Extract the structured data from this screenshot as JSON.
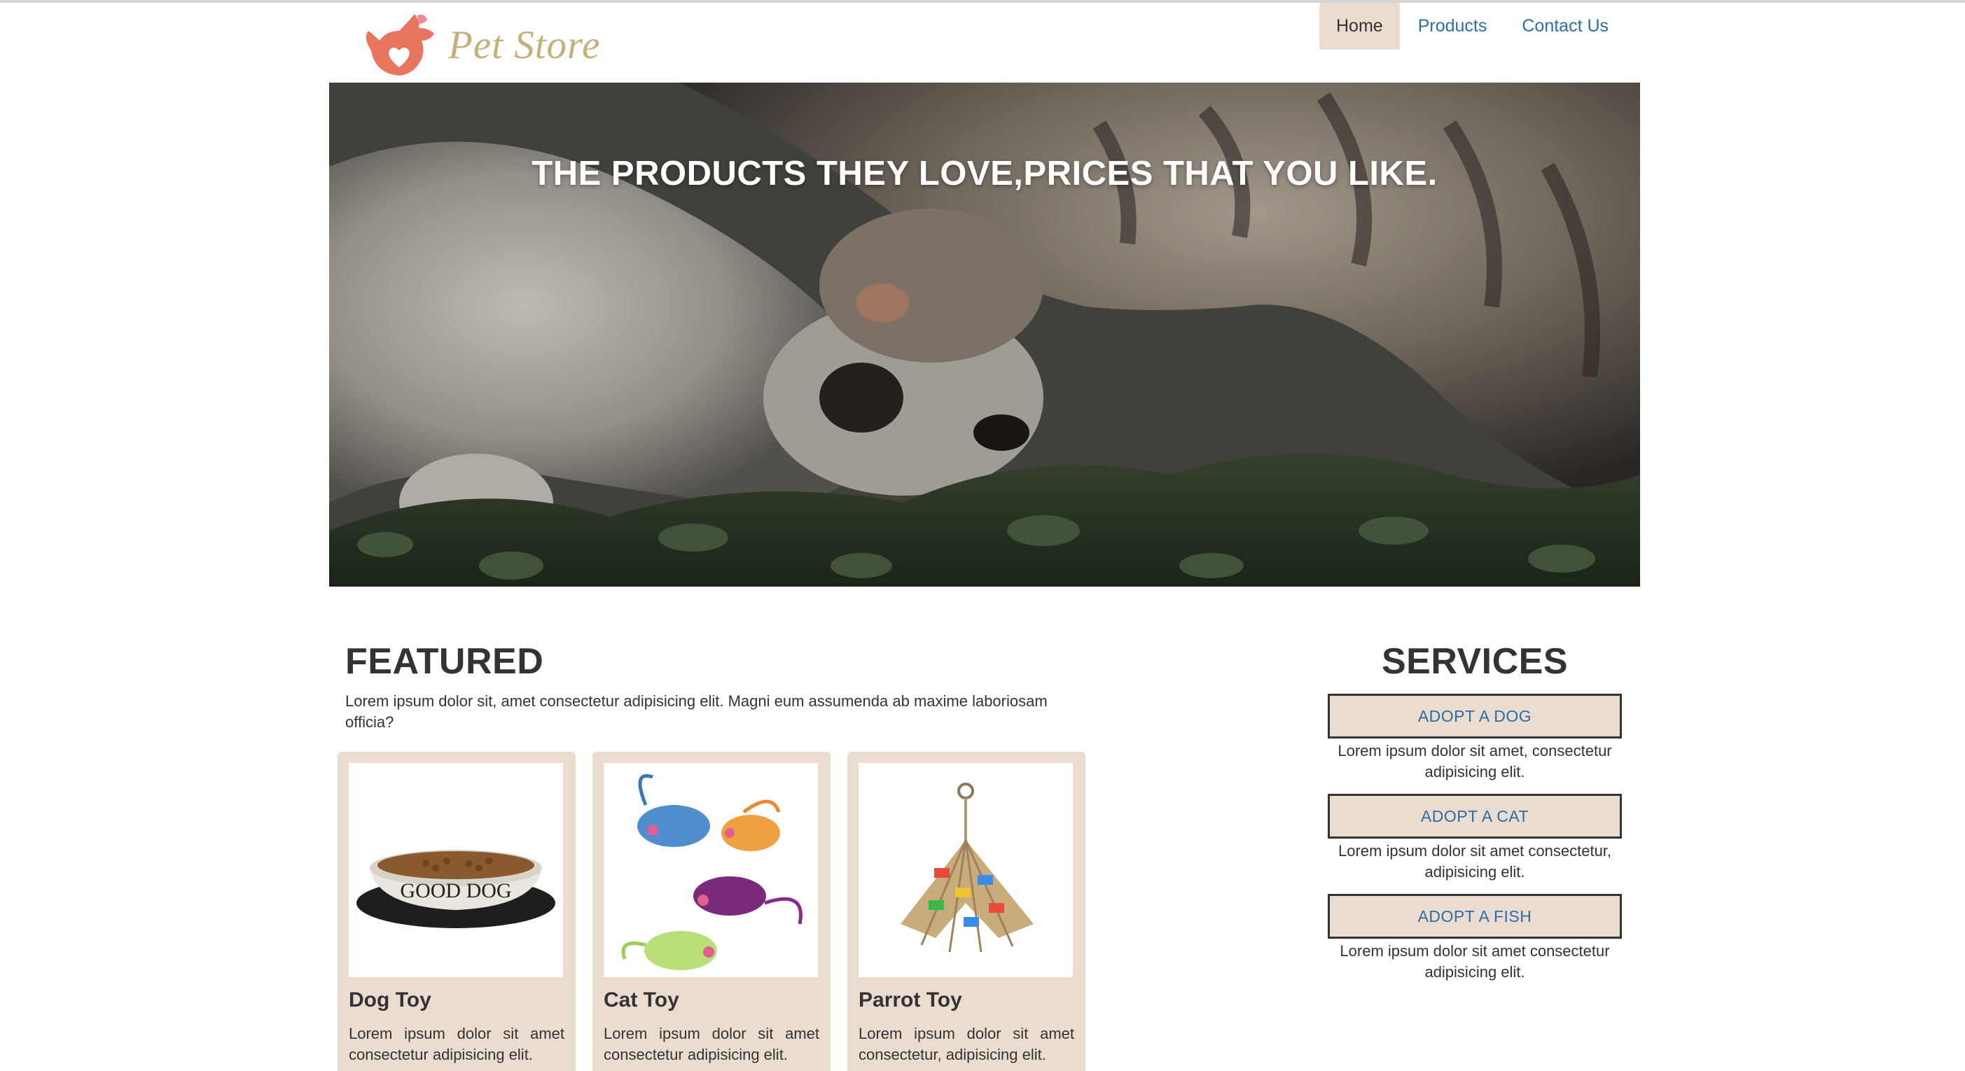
{
  "brand": {
    "name": "Pet Store",
    "logo_icon": "dog-heart-icon",
    "logo_color": "#e8765f"
  },
  "nav": {
    "items": [
      {
        "label": "Home",
        "active": true
      },
      {
        "label": "Products",
        "active": false
      },
      {
        "label": "Contact Us",
        "active": false
      }
    ]
  },
  "hero": {
    "title": "THE PRODUCTS THEY LOVE,PRICES THAT YOU LIKE."
  },
  "featured": {
    "title": "FEATURED",
    "description": "Lorem ipsum dolor sit, amet consectetur adipisicing elit. Magni eum assumenda ab maxime laboriosam officia?",
    "cards": [
      {
        "title": "Dog Toy",
        "text": "Lorem ipsum dolor sit amet consectetur adipisicing elit.",
        "image_label": "GOOD DOG"
      },
      {
        "title": "Cat Toy",
        "text": "Lorem ipsum dolor sit amet consectetur adipisicing elit."
      },
      {
        "title": "Parrot Toy",
        "text": "Lorem ipsum dolor sit amet consectetur, adipisicing elit."
      }
    ]
  },
  "services": {
    "title": "SERVICES",
    "items": [
      {
        "label": "ADOPT A DOG",
        "text": "Lorem ipsum dolor sit amet, consectetur adipisicing elit."
      },
      {
        "label": "ADOPT A CAT",
        "text": "Lorem ipsum dolor sit amet consectetur, adipisicing elit."
      },
      {
        "label": "ADOPT A FISH",
        "text": "Lorem ipsum dolor sit amet consectetur adipisicing elit."
      }
    ]
  },
  "colors": {
    "accent_bg": "#eaddd0",
    "link": "#2d6da6",
    "text": "#333333"
  }
}
